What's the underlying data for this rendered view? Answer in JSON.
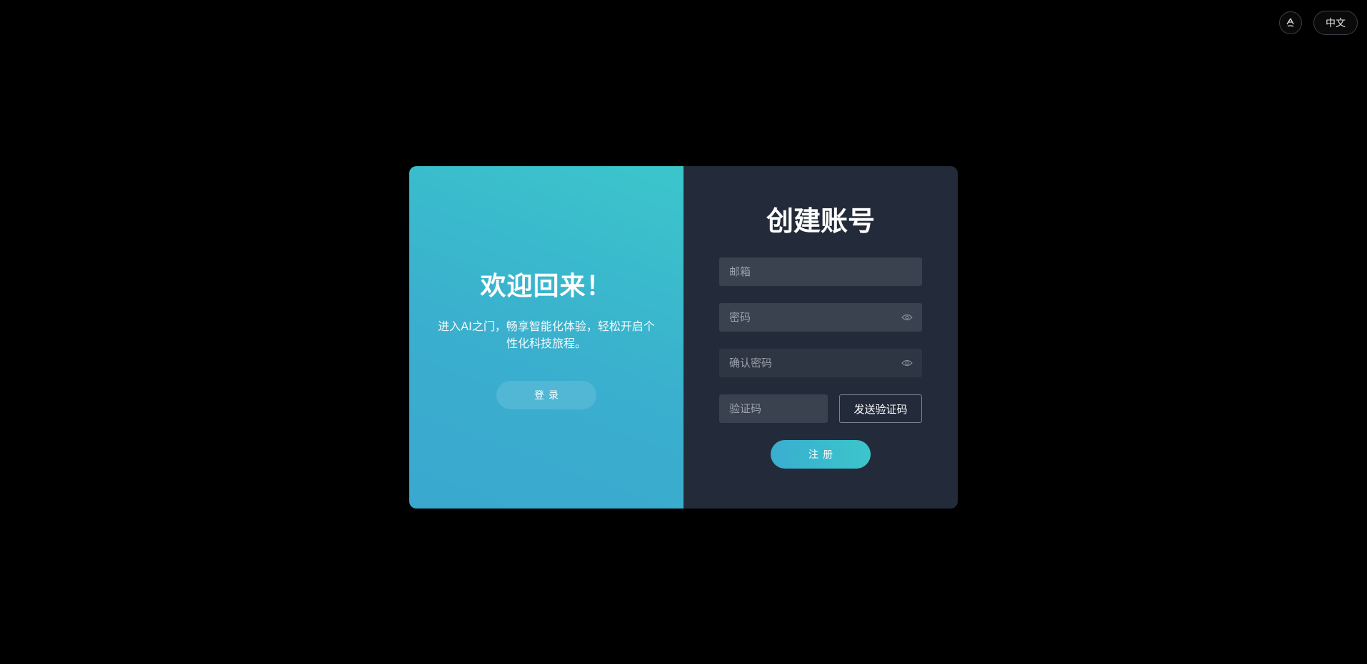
{
  "top_bar": {
    "theme_icon": "theme-toggle-icon",
    "language_label": "中文"
  },
  "left_panel": {
    "title": "欢迎回来！",
    "subtitle": "进入AI之门，畅享智能化体验，轻松开启个性化科技旅程。",
    "login_button": "登录"
  },
  "right_panel": {
    "title": "创建账号",
    "email_placeholder": "邮箱",
    "password_placeholder": "密码",
    "confirm_password_placeholder": "确认密码",
    "code_placeholder": "验证码",
    "send_code_button": "发送验证码",
    "register_button": "注册",
    "eye_icon": "eye-icon"
  },
  "colors": {
    "background": "#000000",
    "left_gradient_start": "#3bc6cb",
    "left_gradient_end": "#3aa8cf",
    "right_panel": "#232b3a",
    "input_background": "#3a4250"
  }
}
